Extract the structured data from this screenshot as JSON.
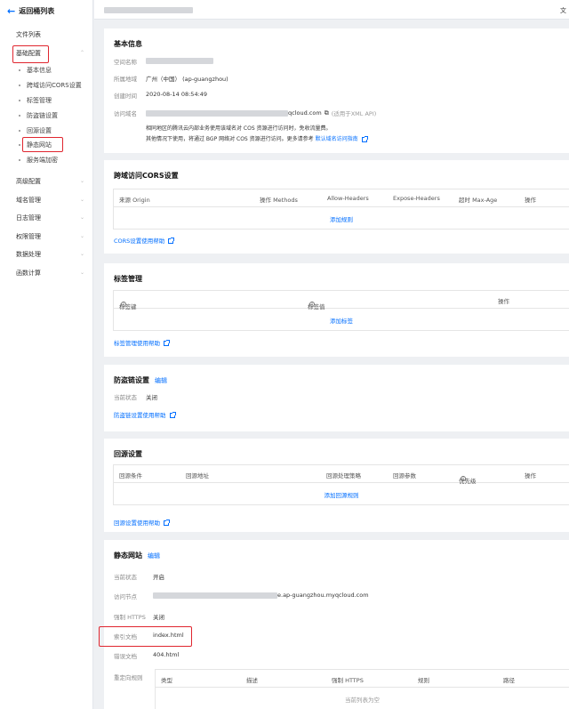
{
  "sidebar": {
    "back_label": "返回桶列表",
    "items": [
      {
        "label": "文件列表"
      },
      {
        "label": "基础配置"
      },
      {
        "label": "高级配置"
      },
      {
        "label": "域名管理"
      },
      {
        "label": "日志管理"
      },
      {
        "label": "权限管理"
      },
      {
        "label": "数据处理"
      },
      {
        "label": "函数计算"
      }
    ],
    "sub_items": [
      {
        "label": "基本信息"
      },
      {
        "label": "跨域访问CORS设置"
      },
      {
        "label": "标签管理"
      },
      {
        "label": "防盗链设置"
      },
      {
        "label": "回源设置"
      },
      {
        "label": "静态网站"
      },
      {
        "label": "服务端加密"
      }
    ],
    "highlight_color": "#e0262f"
  },
  "topbar": {
    "right_text": "文"
  },
  "basic": {
    "title": "基本信息",
    "name_label": "空间名称",
    "region_label": "所属地域",
    "region_value": "广州（中国） (ap-guangzhou)",
    "created_label": "创建时间",
    "created_value": "2020-08-14 08:54:49",
    "domain_label": "访问域名",
    "domain_value": "qcloud.com",
    "domain_note": "(适用于XML API)",
    "note_line1": "相同地区的腾讯云内部业务使用该域名对 COS 资源进行访问时，免收流量费。",
    "note_line2": "其他情况下使用，将通过 BGP 网络对 COS 资源进行访问。更多请参考",
    "note_link": "默认域名访问指南"
  },
  "cors": {
    "title": "跨域访问CORS设置",
    "columns": [
      "来源 Origin",
      "操作 Methods",
      "Allow-Headers",
      "Expose-Headers",
      "超时 Max-Age",
      "操作"
    ],
    "add_label": "添加规则",
    "help": "CORS设置使用帮助"
  },
  "tags": {
    "title": "标签管理",
    "columns": [
      "标签键",
      "标签值",
      "操作"
    ],
    "add_label": "添加标签",
    "help": "标签管理使用帮助"
  },
  "hotlink": {
    "title": "防盗链设置",
    "edit": "编辑",
    "status_label": "当前状态",
    "status_value": "关闭",
    "help": "防盗链设置使用帮助"
  },
  "origin": {
    "title": "回源设置",
    "columns": [
      "回源条件",
      "回源地址",
      "回源处理策略",
      "回源参数",
      "优先级",
      "操作"
    ],
    "add_label": "添加回源规则",
    "help": "回源设置使用帮助"
  },
  "static_site": {
    "title": "静态网站",
    "edit": "编辑",
    "status_label": "当前状态",
    "status_value": "开启",
    "endpoint_label": "访问节点",
    "endpoint_value": "e.ap-guangzhou.myqcloud.com",
    "https_label": "强制 HTTPS",
    "https_value": "关闭",
    "index_label": "索引文档",
    "index_value": "index.html",
    "error_label": "错误文档",
    "error_value": "404.html",
    "redirect_label": "重定向规则",
    "redirect_columns": [
      "类型",
      "描述",
      "强制 HTTPS",
      "规则",
      "路径"
    ],
    "redirect_empty": "当前列表为空"
  }
}
